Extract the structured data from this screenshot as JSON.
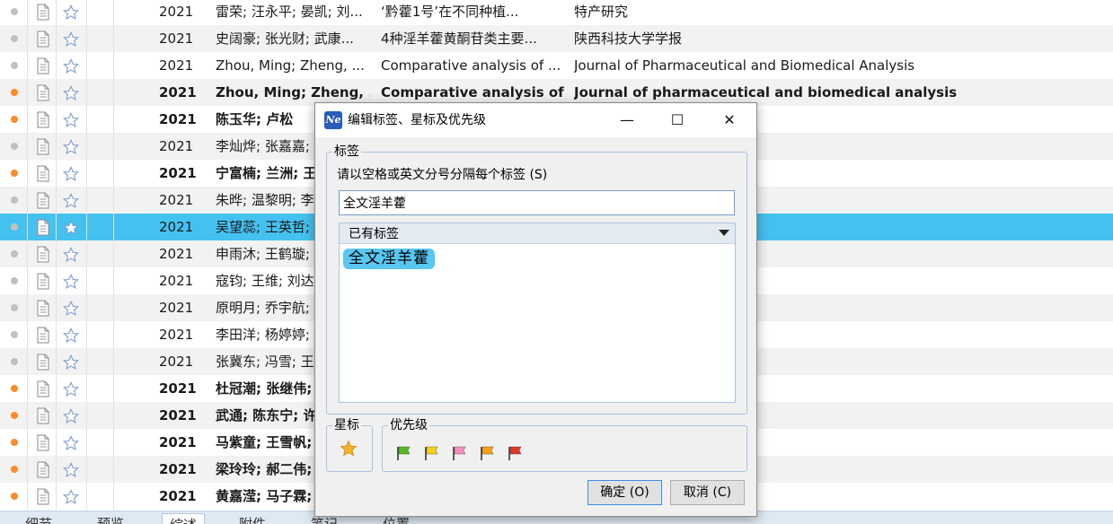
{
  "rows": [
    {
      "read": true,
      "bold": false,
      "year": "2021",
      "authors": "雷荣; 汪永平; 晏凯; 刘...",
      "title": "‘黔藿1号’在不同种植...",
      "journal": "特产研究"
    },
    {
      "read": true,
      "bold": false,
      "year": "2021",
      "authors": "史阔豪; 张光财; 武康...",
      "title": "4种淫羊藿黄酮苷类主要...",
      "journal": "陕西科技大学学报"
    },
    {
      "read": true,
      "bold": false,
      "year": "2021",
      "authors": "Zhou, Ming; Zheng, ...",
      "title": "Comparative analysis of ...",
      "journal": "Journal of Pharmaceutical and Biomedical Analysis"
    },
    {
      "read": false,
      "bold": true,
      "year": "2021",
      "authors": "Zhou, Ming; Zheng, .",
      "title": "Comparative analysis of",
      "journal": "Journal of pharmaceutical and biomedical analysis"
    },
    {
      "read": false,
      "bold": true,
      "year": "2021",
      "authors": "陈玉华; 卢松",
      "title": "",
      "journal": ""
    },
    {
      "read": true,
      "bold": false,
      "year": "2021",
      "authors": "李灿烨; 张嘉嘉;",
      "title": "",
      "journal": ""
    },
    {
      "read": false,
      "bold": true,
      "year": "2021",
      "authors": "宁富楠; 兰洲; 王",
      "title": "",
      "journal": ""
    },
    {
      "read": true,
      "bold": false,
      "year": "2021",
      "authors": "朱晔; 温黎明; 李",
      "title": "",
      "journal": ""
    },
    {
      "read": true,
      "bold": false,
      "year": "2021",
      "authors": "吴望蕊; 王英哲;",
      "title": "",
      "journal": "",
      "selected": true
    },
    {
      "read": true,
      "bold": false,
      "year": "2021",
      "authors": "申雨沐; 王鹤璇;",
      "title": "",
      "journal": ""
    },
    {
      "read": true,
      "bold": false,
      "year": "2021",
      "authors": "寇钧; 王维; 刘达",
      "title": "",
      "journal": ""
    },
    {
      "read": true,
      "bold": false,
      "year": "2021",
      "authors": "原明月; 乔宇航;",
      "title": "",
      "journal": ""
    },
    {
      "read": true,
      "bold": false,
      "year": "2021",
      "authors": "李田洋; 杨婷婷;",
      "title": "",
      "journal": ""
    },
    {
      "read": true,
      "bold": false,
      "year": "2021",
      "authors": "张冀东; 冯雪; 王",
      "title": "",
      "journal": ""
    },
    {
      "read": false,
      "bold": true,
      "year": "2021",
      "authors": "杜冠潮; 张继伟;",
      "title": "",
      "journal": ""
    },
    {
      "read": false,
      "bold": true,
      "year": "2021",
      "authors": "武通; 陈东宁; 许",
      "title": "",
      "journal": ""
    },
    {
      "read": false,
      "bold": true,
      "year": "2021",
      "authors": "马紫童; 王雪帆;",
      "title": "",
      "journal": ""
    },
    {
      "read": false,
      "bold": true,
      "year": "2021",
      "authors": "梁玲玲; 郝二伟;",
      "title": "",
      "journal": ""
    },
    {
      "read": false,
      "bold": true,
      "year": "2021",
      "authors": "黄嘉滢; 马子霖;",
      "title": "",
      "journal": ""
    }
  ],
  "bottom_tabs": [
    "细节",
    "预览",
    "综述",
    "附件",
    "笔记",
    "位置"
  ],
  "dialog": {
    "title": "编辑标签、星标及优先级",
    "app_icon": "Ne",
    "minimize": "—",
    "maximize": "☐",
    "close": "✕",
    "tags_legend": "标签",
    "tags_hint": "请以空格或英文分号分隔每个标签 (S)",
    "tags_value": "全文淫羊藿",
    "existing_tags_label": "已有标签",
    "existing_tags": [
      "全文淫羊藿"
    ],
    "star_legend": "星标",
    "priority_legend": "优先级",
    "ok_label": "确定 (O)",
    "cancel_label": "取消 (C)"
  },
  "colors": {
    "selected_row": "#45c1f0",
    "unread_dot": "#ff8a2a",
    "read_dot": "#c0c0c0",
    "tag_chip": "#59c7f2",
    "flags": [
      "#5ab828",
      "#f4d21a",
      "#f48fc0",
      "#f7a21a",
      "#e03a2a"
    ]
  }
}
